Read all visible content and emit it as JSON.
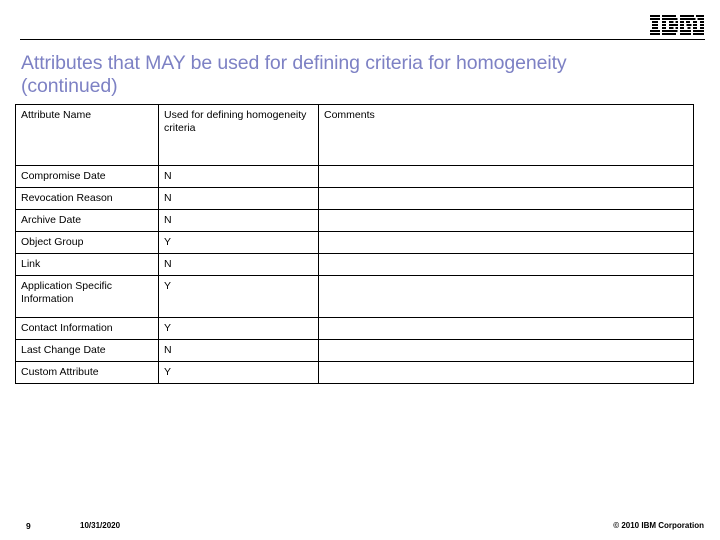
{
  "header": {
    "logo_name": "ibm-logo",
    "logo_text": "IBM"
  },
  "title": {
    "text": "Attributes that MAY be used for defining criteria for homogeneity\n(continued)",
    "color": "#7d81c4"
  },
  "table": {
    "columns": [
      "Attribute Name",
      "Used for defining homogeneity criteria",
      "Comments"
    ],
    "rows": [
      {
        "name": "Compromise Date",
        "used": "N",
        "comments": "",
        "tall": false
      },
      {
        "name": "Revocation Reason",
        "used": "N",
        "comments": "",
        "tall": false
      },
      {
        "name": "Archive Date",
        "used": "N",
        "comments": "",
        "tall": false
      },
      {
        "name": "Object Group",
        "used": "Y",
        "comments": "",
        "tall": false
      },
      {
        "name": "Link",
        "used": "N",
        "comments": "",
        "tall": false
      },
      {
        "name": "Application Specific Information",
        "used": "Y",
        "comments": "",
        "tall": true
      },
      {
        "name": "Contact Information",
        "used": "Y",
        "comments": "",
        "tall": false
      },
      {
        "name": "Last Change Date",
        "used": "N",
        "comments": "",
        "tall": false
      },
      {
        "name": "Custom Attribute",
        "used": "Y",
        "comments": "",
        "tall": false
      }
    ]
  },
  "footer": {
    "page_number": "9",
    "date": "10/31/2020",
    "copyright": "© 2010 IBM Corporation"
  }
}
